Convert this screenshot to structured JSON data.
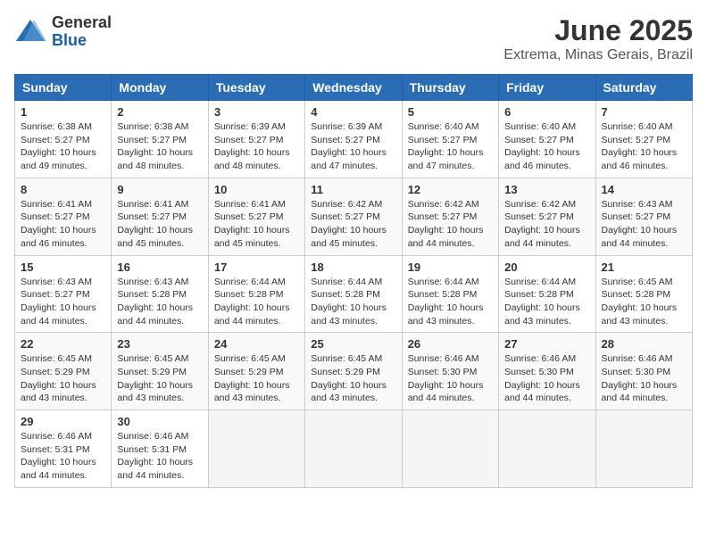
{
  "logo": {
    "general": "General",
    "blue": "Blue"
  },
  "title": "June 2025",
  "subtitle": "Extrema, Minas Gerais, Brazil",
  "headers": [
    "Sunday",
    "Monday",
    "Tuesday",
    "Wednesday",
    "Thursday",
    "Friday",
    "Saturday"
  ],
  "weeks": [
    [
      {
        "day": "1",
        "sunrise": "6:38 AM",
        "sunset": "5:27 PM",
        "daylight": "10 hours and 49 minutes."
      },
      {
        "day": "2",
        "sunrise": "6:38 AM",
        "sunset": "5:27 PM",
        "daylight": "10 hours and 48 minutes."
      },
      {
        "day": "3",
        "sunrise": "6:39 AM",
        "sunset": "5:27 PM",
        "daylight": "10 hours and 48 minutes."
      },
      {
        "day": "4",
        "sunrise": "6:39 AM",
        "sunset": "5:27 PM",
        "daylight": "10 hours and 47 minutes."
      },
      {
        "day": "5",
        "sunrise": "6:40 AM",
        "sunset": "5:27 PM",
        "daylight": "10 hours and 47 minutes."
      },
      {
        "day": "6",
        "sunrise": "6:40 AM",
        "sunset": "5:27 PM",
        "daylight": "10 hours and 46 minutes."
      },
      {
        "day": "7",
        "sunrise": "6:40 AM",
        "sunset": "5:27 PM",
        "daylight": "10 hours and 46 minutes."
      }
    ],
    [
      {
        "day": "8",
        "sunrise": "6:41 AM",
        "sunset": "5:27 PM",
        "daylight": "10 hours and 46 minutes."
      },
      {
        "day": "9",
        "sunrise": "6:41 AM",
        "sunset": "5:27 PM",
        "daylight": "10 hours and 45 minutes."
      },
      {
        "day": "10",
        "sunrise": "6:41 AM",
        "sunset": "5:27 PM",
        "daylight": "10 hours and 45 minutes."
      },
      {
        "day": "11",
        "sunrise": "6:42 AM",
        "sunset": "5:27 PM",
        "daylight": "10 hours and 45 minutes."
      },
      {
        "day": "12",
        "sunrise": "6:42 AM",
        "sunset": "5:27 PM",
        "daylight": "10 hours and 44 minutes."
      },
      {
        "day": "13",
        "sunrise": "6:42 AM",
        "sunset": "5:27 PM",
        "daylight": "10 hours and 44 minutes."
      },
      {
        "day": "14",
        "sunrise": "6:43 AM",
        "sunset": "5:27 PM",
        "daylight": "10 hours and 44 minutes."
      }
    ],
    [
      {
        "day": "15",
        "sunrise": "6:43 AM",
        "sunset": "5:27 PM",
        "daylight": "10 hours and 44 minutes."
      },
      {
        "day": "16",
        "sunrise": "6:43 AM",
        "sunset": "5:28 PM",
        "daylight": "10 hours and 44 minutes."
      },
      {
        "day": "17",
        "sunrise": "6:44 AM",
        "sunset": "5:28 PM",
        "daylight": "10 hours and 44 minutes."
      },
      {
        "day": "18",
        "sunrise": "6:44 AM",
        "sunset": "5:28 PM",
        "daylight": "10 hours and 43 minutes."
      },
      {
        "day": "19",
        "sunrise": "6:44 AM",
        "sunset": "5:28 PM",
        "daylight": "10 hours and 43 minutes."
      },
      {
        "day": "20",
        "sunrise": "6:44 AM",
        "sunset": "5:28 PM",
        "daylight": "10 hours and 43 minutes."
      },
      {
        "day": "21",
        "sunrise": "6:45 AM",
        "sunset": "5:28 PM",
        "daylight": "10 hours and 43 minutes."
      }
    ],
    [
      {
        "day": "22",
        "sunrise": "6:45 AM",
        "sunset": "5:29 PM",
        "daylight": "10 hours and 43 minutes."
      },
      {
        "day": "23",
        "sunrise": "6:45 AM",
        "sunset": "5:29 PM",
        "daylight": "10 hours and 43 minutes."
      },
      {
        "day": "24",
        "sunrise": "6:45 AM",
        "sunset": "5:29 PM",
        "daylight": "10 hours and 43 minutes."
      },
      {
        "day": "25",
        "sunrise": "6:45 AM",
        "sunset": "5:29 PM",
        "daylight": "10 hours and 43 minutes."
      },
      {
        "day": "26",
        "sunrise": "6:46 AM",
        "sunset": "5:30 PM",
        "daylight": "10 hours and 44 minutes."
      },
      {
        "day": "27",
        "sunrise": "6:46 AM",
        "sunset": "5:30 PM",
        "daylight": "10 hours and 44 minutes."
      },
      {
        "day": "28",
        "sunrise": "6:46 AM",
        "sunset": "5:30 PM",
        "daylight": "10 hours and 44 minutes."
      }
    ],
    [
      {
        "day": "29",
        "sunrise": "6:46 AM",
        "sunset": "5:31 PM",
        "daylight": "10 hours and 44 minutes."
      },
      {
        "day": "30",
        "sunrise": "6:46 AM",
        "sunset": "5:31 PM",
        "daylight": "10 hours and 44 minutes."
      },
      null,
      null,
      null,
      null,
      null
    ]
  ]
}
